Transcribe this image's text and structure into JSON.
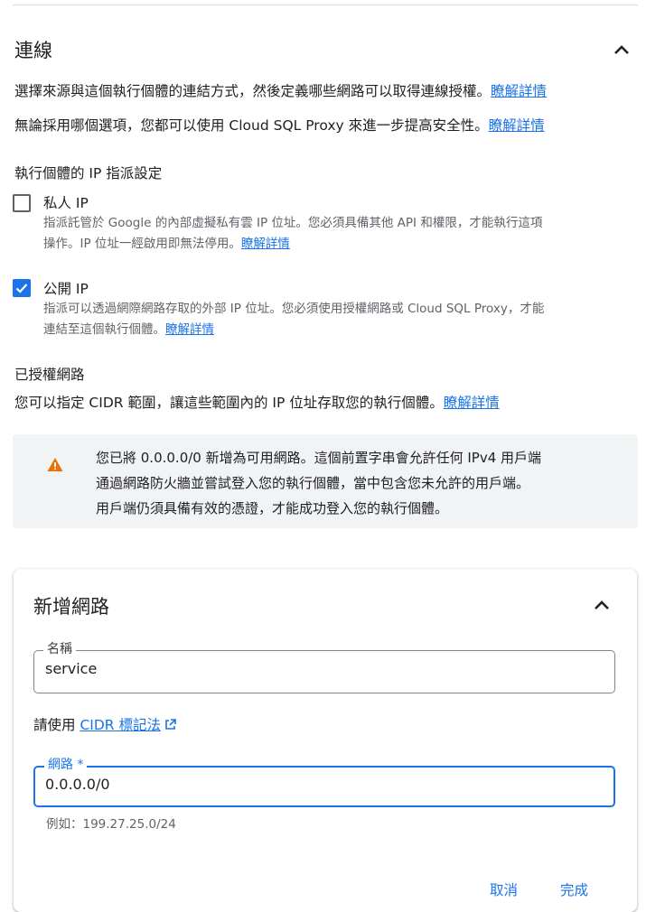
{
  "connection": {
    "title": "連線",
    "desc1": "選擇來源與這個執行個體的連結方式，然後定義哪些網路可以取得連線授權。",
    "desc2": "無論採用哪個選項，您都可以使用 Cloud SQL Proxy 來進一步提高安全性。",
    "learn_more": "瞭解詳情"
  },
  "ip_assignment": {
    "label": "執行個體的 IP 指派設定",
    "private_ip": {
      "title": "私人 IP",
      "checked": false,
      "desc_line1": "指派託管於 Google 的內部虛擬私有雲 IP 位址。您必須具備其他 API 和權限，才能執行這項",
      "desc_line2": "操作。IP 位址一經啟用即無法停用。"
    },
    "public_ip": {
      "title": "公開 IP",
      "checked": true,
      "desc_line1": "指派可以透過網際網路存取的外部 IP 位址。您必須使用授權網路或 Cloud SQL Proxy，才能",
      "desc_line2": "連結至這個執行個體。"
    }
  },
  "authorized_networks": {
    "label": "已授權網路",
    "desc": "您可以指定 CIDR 範圍，讓這些範圍內的 IP 位址存取您的執行個體。"
  },
  "warning": {
    "line1": "您已將 0.0.0.0/0 新增為可用網路。這個前置字串會允許任何 IPv4 用戶端",
    "line2": "通過網路防火牆並嘗試登入您的執行個體，當中包含您未允許的用戶端。",
    "line3": "用戶端仍須具備有效的憑證，才能成功登入您的執行個體。",
    "color": "#c5221f"
  },
  "new_network": {
    "title": "新增網路",
    "name_label": "名稱",
    "name_value": "service",
    "hint_prefix": "請使用",
    "hint_link": "CIDR 標記法",
    "network_label": "網路 *",
    "network_value": "0.0.0.0/0",
    "helper": "例如：199.27.25.0/24",
    "cancel": "取消",
    "done": "完成"
  },
  "colors": {
    "accent": "#1a73e8",
    "warning_icon": "#e8710a"
  },
  "icons": {
    "collapse": "chevron-up-icon",
    "check": "check-icon",
    "warning": "warning-icon",
    "external": "open-in-new-icon"
  }
}
